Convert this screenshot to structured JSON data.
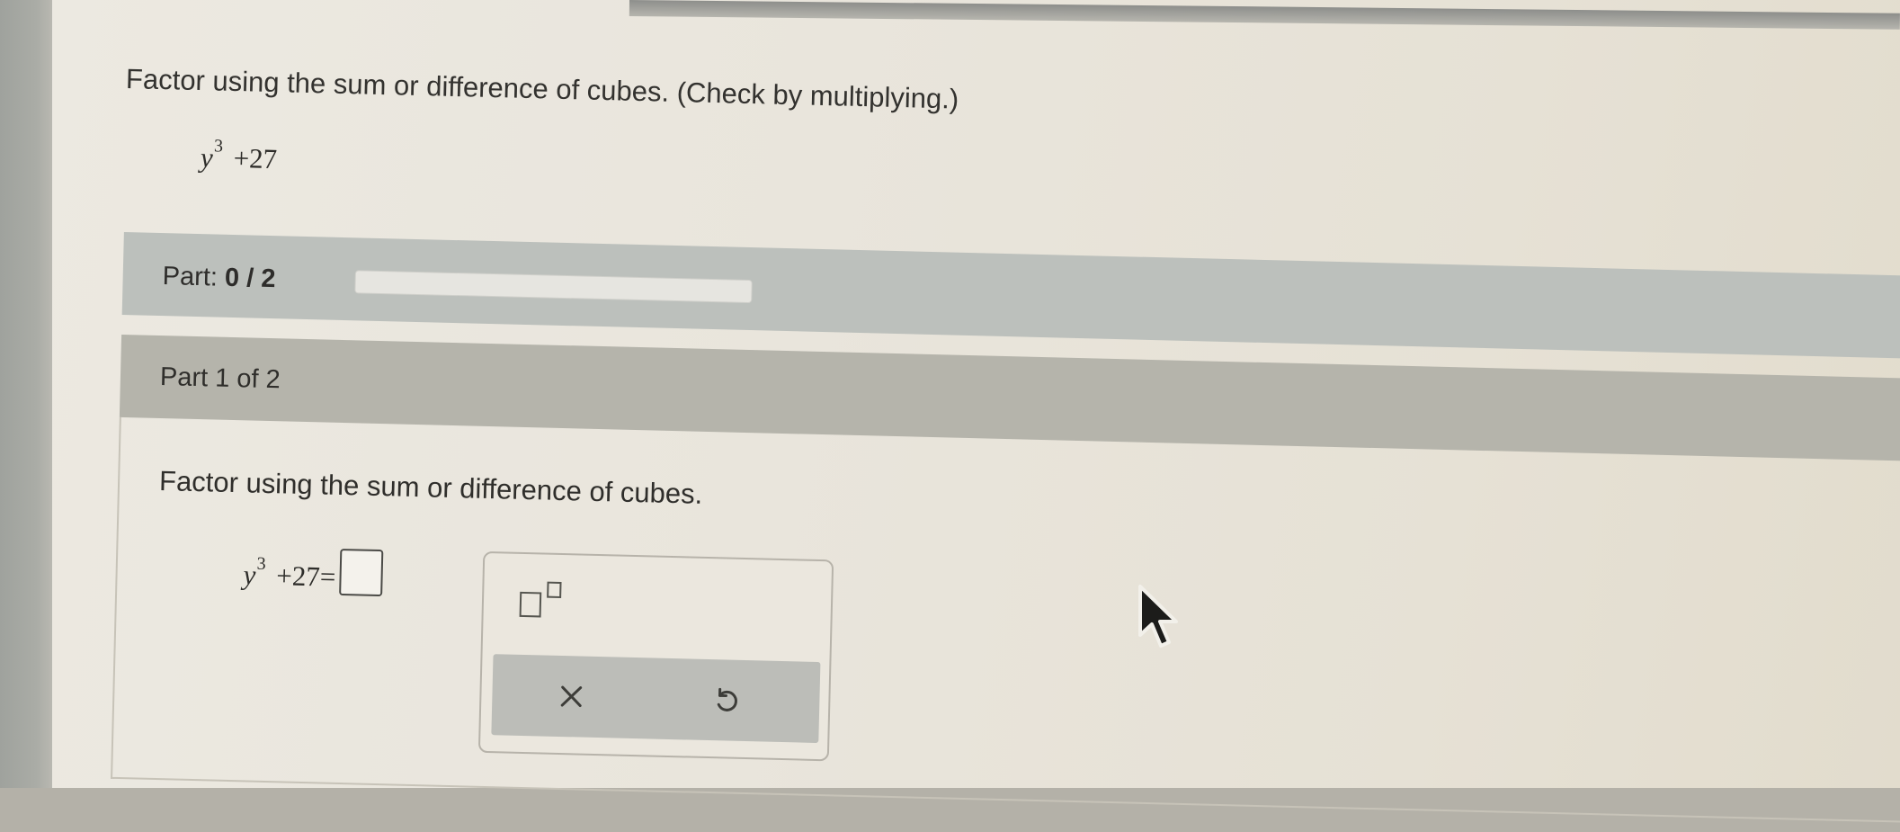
{
  "question": {
    "prompt": "Factor using the sum or difference of cubes. (Check by multiplying.)",
    "expression": {
      "variable": "y",
      "exponent": "3",
      "rest": "+27"
    }
  },
  "progress": {
    "label": "Part:",
    "value": "0 / 2",
    "fraction": 0
  },
  "part": {
    "header": "Part 1 of 2",
    "instruction": "Factor using the sum or difference of cubes.",
    "answer": {
      "variable": "y",
      "exponent": "3",
      "rest": "+27=",
      "value": ""
    }
  },
  "palette": {
    "buttons": [
      {
        "name": "exponent-template-icon"
      },
      {
        "name": "clear-icon"
      },
      {
        "name": "undo-icon"
      }
    ]
  },
  "colors": {
    "progress_fill": "#5a8fc8",
    "part_bar": "#bcc0bc",
    "part_header": "#b5b4ab"
  }
}
